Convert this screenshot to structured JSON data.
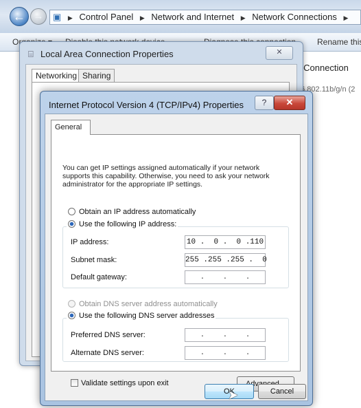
{
  "explorer": {
    "breadcrumb": [
      "Control Panel",
      "Network and Internet",
      "Network Connections"
    ],
    "toolbar": {
      "organize": "Organize ▾",
      "disable": "Disable this network device",
      "diagnose": "Diagnose this connection",
      "rename": "Rename this"
    },
    "connection_name_fragment": "k Connection",
    "connection_device_fragment": "06.802.11b/g/n (2"
  },
  "back_dialog": {
    "title": "Local Area Connection Properties",
    "tabs": [
      "Networking",
      "Sharing"
    ]
  },
  "dialog": {
    "title": "Internet Protocol Version 4 (TCP/IPv4) Properties",
    "help_glyph": "?",
    "close_glyph": "✕",
    "tab": "General",
    "intro": "You can get IP settings assigned automatically if your network supports this capability. Otherwise, you need to ask your network administrator for the appropriate IP settings.",
    "ip_auto_label": "Obtain an IP address automatically",
    "ip_manual_label": "Use the following IP address:",
    "ip_address_label": "IP address:",
    "ip_address_value": "10 .  0 .  0 .110",
    "subnet_label": "Subnet mask:",
    "subnet_value": "255 .255 .255 .  0",
    "gateway_label": "Default gateway:",
    "gateway_value": " .    .    . ",
    "dns_auto_label": "Obtain DNS server address automatically",
    "dns_manual_label": "Use the following DNS server addresses",
    "preferred_dns_label": "Preferred DNS server:",
    "preferred_dns_value": " .    .    . ",
    "alternate_dns_label": "Alternate DNS server:",
    "alternate_dns_value": " .    .    . ",
    "validate_label": "Validate settings upon exit",
    "advanced_label": "Advanced...",
    "ok_label": "OK",
    "cancel_label": "Cancel"
  }
}
